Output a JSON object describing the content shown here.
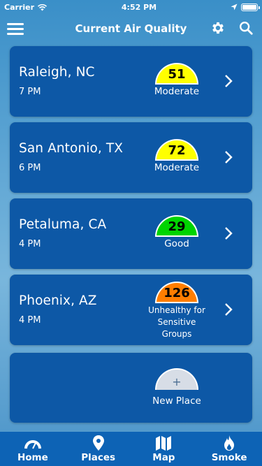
{
  "status": {
    "carrier": "Carrier",
    "time": "4:52 PM"
  },
  "nav": {
    "title": "Current Air Quality"
  },
  "places": [
    {
      "city": "Raleigh, NC",
      "time": "7 PM",
      "aqi": "51",
      "category": "Moderate",
      "color": "#ffff00"
    },
    {
      "city": "San Antonio, TX",
      "time": "6 PM",
      "aqi": "72",
      "category": "Moderate",
      "color": "#ffff00"
    },
    {
      "city": "Petaluma, CA",
      "time": "4 PM",
      "aqi": "29",
      "category": "Good",
      "color": "#00d400"
    },
    {
      "city": "Phoenix, AZ",
      "time": "4 PM",
      "aqi": "126",
      "category": "Unhealthy for Sensitive Groups",
      "color": "#ff7e00"
    }
  ],
  "add_place": {
    "symbol": "+",
    "label": "New Place"
  },
  "tabs": [
    {
      "label": "Home",
      "icon": "gauge-icon"
    },
    {
      "label": "Places",
      "icon": "location-pin-icon"
    },
    {
      "label": "Map",
      "icon": "map-icon"
    },
    {
      "label": "Smoke",
      "icon": "fire-icon"
    }
  ],
  "colors": {
    "card": "#0d58a6",
    "tab_bar": "#0d63b5"
  }
}
